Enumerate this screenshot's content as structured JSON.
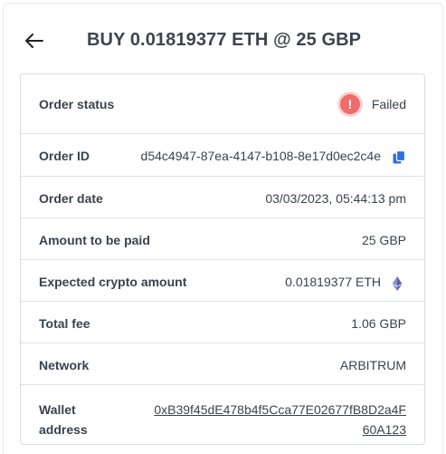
{
  "header": {
    "title": "BUY 0.01819377 ETH @ 25 GBP"
  },
  "details": {
    "order_status": {
      "label": "Order status",
      "value": "Failed",
      "icon": "exclamation-icon",
      "color": "#f06b6b"
    },
    "order_id": {
      "label": "Order ID",
      "value": "d54c4947-87ea-4147-b108-8e17d0ec2c4e",
      "icon": "copy-icon",
      "color": "#2f6fe0"
    },
    "order_date": {
      "label": "Order date",
      "value": "03/03/2023, 05:44:13 pm"
    },
    "amount_paid": {
      "label": "Amount to be paid",
      "value": "25 GBP"
    },
    "crypto_amount": {
      "label": "Expected crypto amount",
      "value": "0.01819377 ETH",
      "icon": "ethereum-icon"
    },
    "total_fee": {
      "label": "Total fee",
      "value": "1.06 GBP"
    },
    "network": {
      "label": "Network",
      "value": "ARBITRUM"
    },
    "wallet": {
      "label_line1": "Wallet",
      "label_line2": "address",
      "value": "0xB39f45dE478b4f5Cca77E02677fB8D2a4F60A123"
    }
  }
}
